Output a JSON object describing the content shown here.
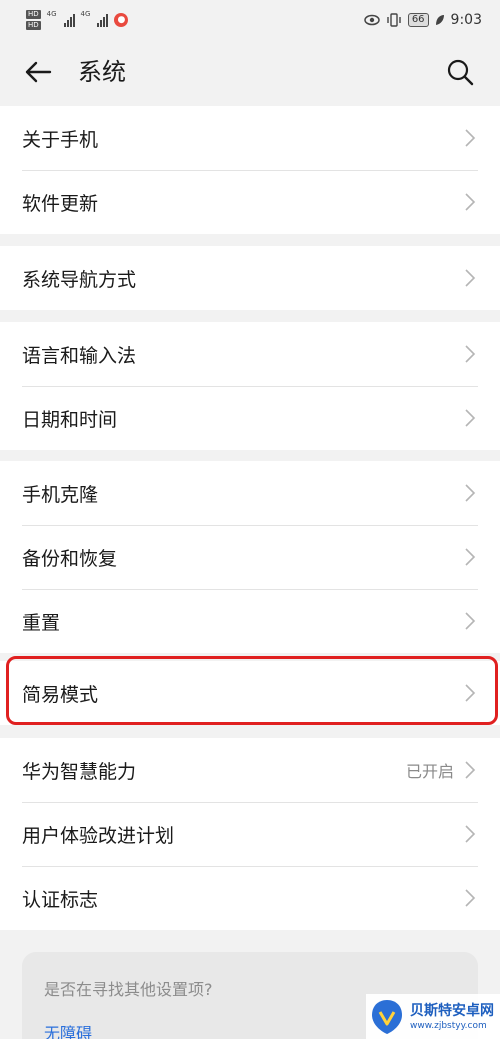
{
  "status_bar": {
    "left_labels": [
      "HD",
      "HD",
      "4G",
      "4G"
    ],
    "time": "9:03",
    "battery": "66",
    "icons": [
      "hd-icon",
      "signal-icon",
      "app-notification-icon",
      "eye-comfort-icon",
      "vibrate-icon",
      "battery-icon",
      "leaf-icon"
    ]
  },
  "app_bar": {
    "title": "系统",
    "icons": [
      "back-arrow-icon",
      "search-icon"
    ]
  },
  "groups": [
    {
      "items": [
        {
          "label": "关于手机"
        },
        {
          "label": "软件更新"
        }
      ]
    },
    {
      "items": [
        {
          "label": "系统导航方式"
        }
      ]
    },
    {
      "items": [
        {
          "label": "语言和输入法"
        },
        {
          "label": "日期和时间"
        }
      ]
    },
    {
      "items": [
        {
          "label": "手机克隆"
        },
        {
          "label": "备份和恢复"
        },
        {
          "label": "重置"
        }
      ]
    },
    {
      "items": [
        {
          "label": "简易模式"
        }
      ]
    },
    {
      "items": [
        {
          "label": "华为智慧能力",
          "status": "已开启"
        },
        {
          "label": "用户体验改进计划"
        },
        {
          "label": "认证标志"
        }
      ]
    }
  ],
  "suggestion": {
    "question": "是否在寻找其他设置项?",
    "link": "无障碍"
  },
  "watermark": {
    "title": "贝斯特安卓网",
    "url": "www.zjbstyy.com"
  },
  "colors": {
    "highlight": "#e02020",
    "link": "#2a6fdb",
    "background": "#f2f2f2"
  }
}
